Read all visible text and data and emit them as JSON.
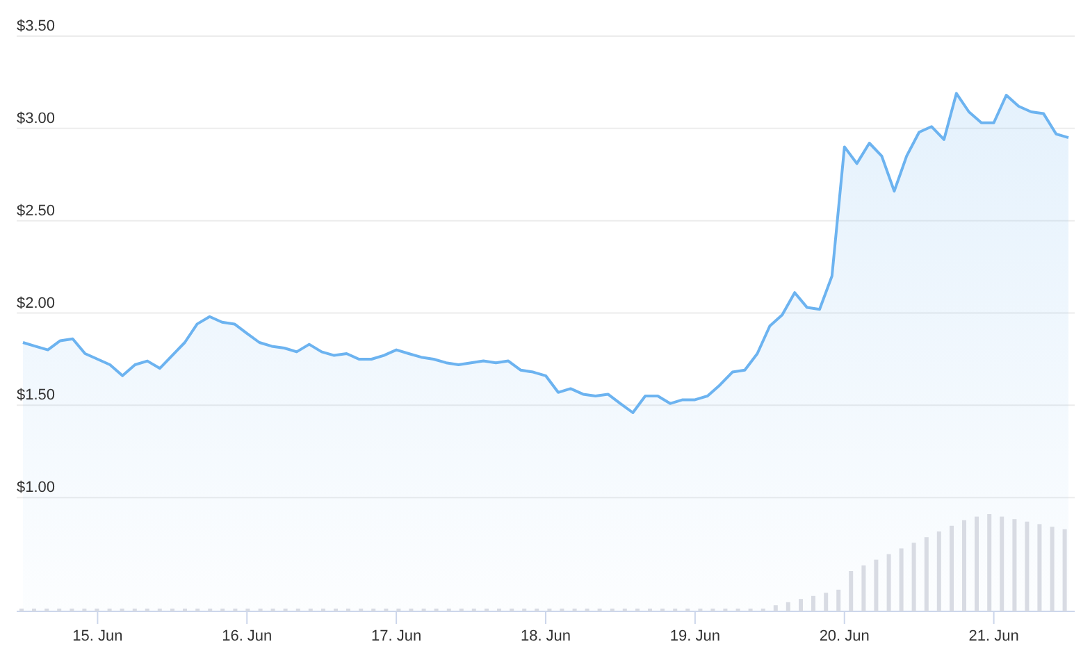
{
  "price_chart": {
    "chart_data": {
      "type": "area",
      "categories": [
        null,
        null,
        null,
        null,
        null,
        null,
        "15. Jun",
        null,
        null,
        null,
        null,
        null,
        null,
        null,
        null,
        null,
        null,
        null,
        "16. Jun",
        null,
        null,
        null,
        null,
        null,
        null,
        null,
        null,
        null,
        null,
        null,
        "17. Jun",
        null,
        null,
        null,
        null,
        null,
        null,
        null,
        null,
        null,
        null,
        null,
        "18. Jun",
        null,
        null,
        null,
        null,
        null,
        null,
        null,
        null,
        null,
        null,
        null,
        "19. Jun",
        null,
        null,
        null,
        null,
        null,
        null,
        null,
        null,
        null,
        null,
        null,
        "20. Jun",
        null,
        null,
        null,
        null,
        null,
        null,
        null,
        null,
        null,
        null,
        null,
        "21. Jun",
        null,
        null,
        null,
        null,
        null,
        null
      ],
      "series": [
        {
          "color": "#6cb3f0",
          "values": [
            1.84,
            1.82,
            1.8,
            1.85,
            1.86,
            1.78,
            1.75,
            1.72,
            1.66,
            1.72,
            1.74,
            1.7,
            1.77,
            1.84,
            1.94,
            1.98,
            1.95,
            1.94,
            1.89,
            1.84,
            1.82,
            1.81,
            1.79,
            1.83,
            1.79,
            1.77,
            1.78,
            1.75,
            1.75,
            1.77,
            1.8,
            1.78,
            1.76,
            1.75,
            1.73,
            1.72,
            1.73,
            1.74,
            1.73,
            1.74,
            1.69,
            1.68,
            1.66,
            1.57,
            1.59,
            1.56,
            1.55,
            1.56,
            1.51,
            1.46,
            1.55,
            1.55,
            1.51,
            1.53,
            1.53,
            1.55,
            1.61,
            1.68,
            1.69,
            1.78,
            1.93,
            1.99,
            2.11,
            2.03,
            2.02,
            2.2,
            2.9,
            2.81,
            2.92,
            2.85,
            2.66,
            2.85,
            2.98,
            3.01,
            2.94,
            3.19,
            3.09,
            3.03,
            3.03,
            3.18,
            3.12,
            3.09,
            3.08,
            2.97,
            2.95
          ]
        }
      ],
      "ylim": [
        0.12,
        3.5
      ],
      "grid": true,
      "yticks": [
        {
          "value": 1,
          "label": "$1.00"
        },
        {
          "value": 1.5,
          "label": "$1.50"
        },
        {
          "value": 2,
          "label": "$2.00"
        },
        {
          "value": 2.5,
          "label": "$2.50"
        },
        {
          "value": 3,
          "label": "$3.00"
        },
        {
          "value": 3.5,
          "label": "$3.50"
        }
      ]
    }
  }
}
